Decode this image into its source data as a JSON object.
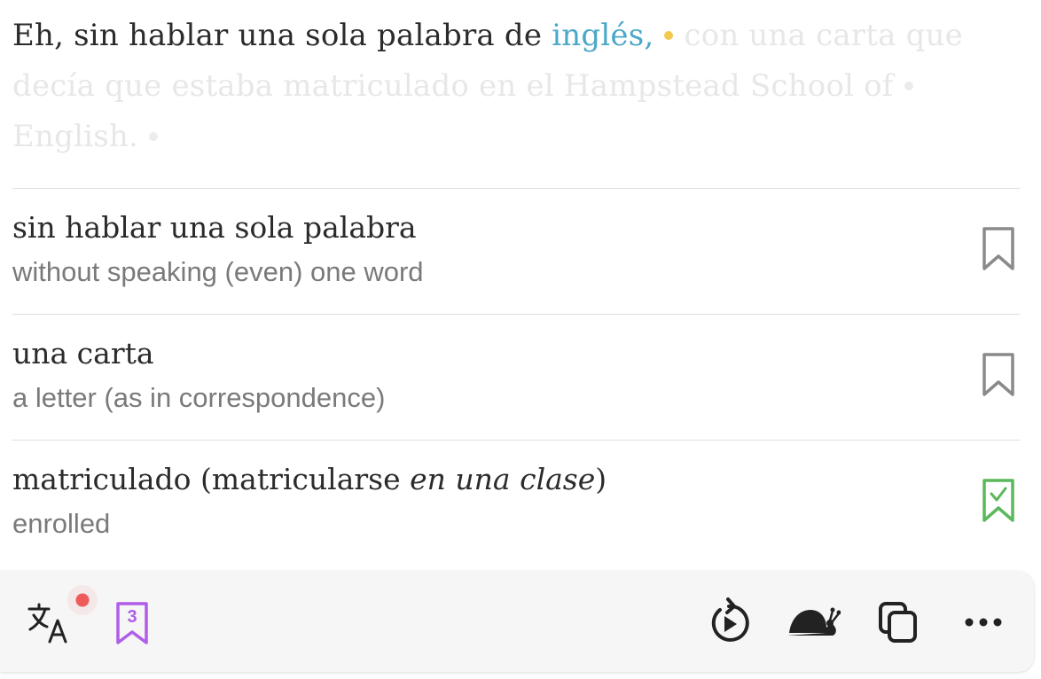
{
  "sentence": {
    "heard": "Eh, sin hablar una sola palabra de ",
    "active": "inglés,",
    "upcoming_1": "con una carta que decía que estaba matriculado en el Hampstead School of",
    "upcoming_2": "English."
  },
  "phrases": [
    {
      "text": "sin hablar una sola palabra",
      "translation": "without speaking (even) one word",
      "saved": false
    },
    {
      "text": "una carta",
      "translation": "a letter (as in correspondence)",
      "saved": false
    },
    {
      "text": "matriculado (matricularse ",
      "text_italic": "en una clase",
      "text_end": ")",
      "translation": "enrolled",
      "saved": true
    }
  ],
  "toolbar": {
    "saved_count": "3",
    "icons": [
      "translate-icon",
      "bookmark-count-icon",
      "replay-icon",
      "snail-icon",
      "copy-icon",
      "more-icon"
    ]
  },
  "colors": {
    "active_word": "#4aa8c9",
    "playhead_dot": "#f2c94c",
    "saved_bookmark": "#5cb85c",
    "unsaved_bookmark": "#8a8a8a",
    "saved_count": "#b05ee8",
    "notification_dot": "#ee5a5a"
  }
}
